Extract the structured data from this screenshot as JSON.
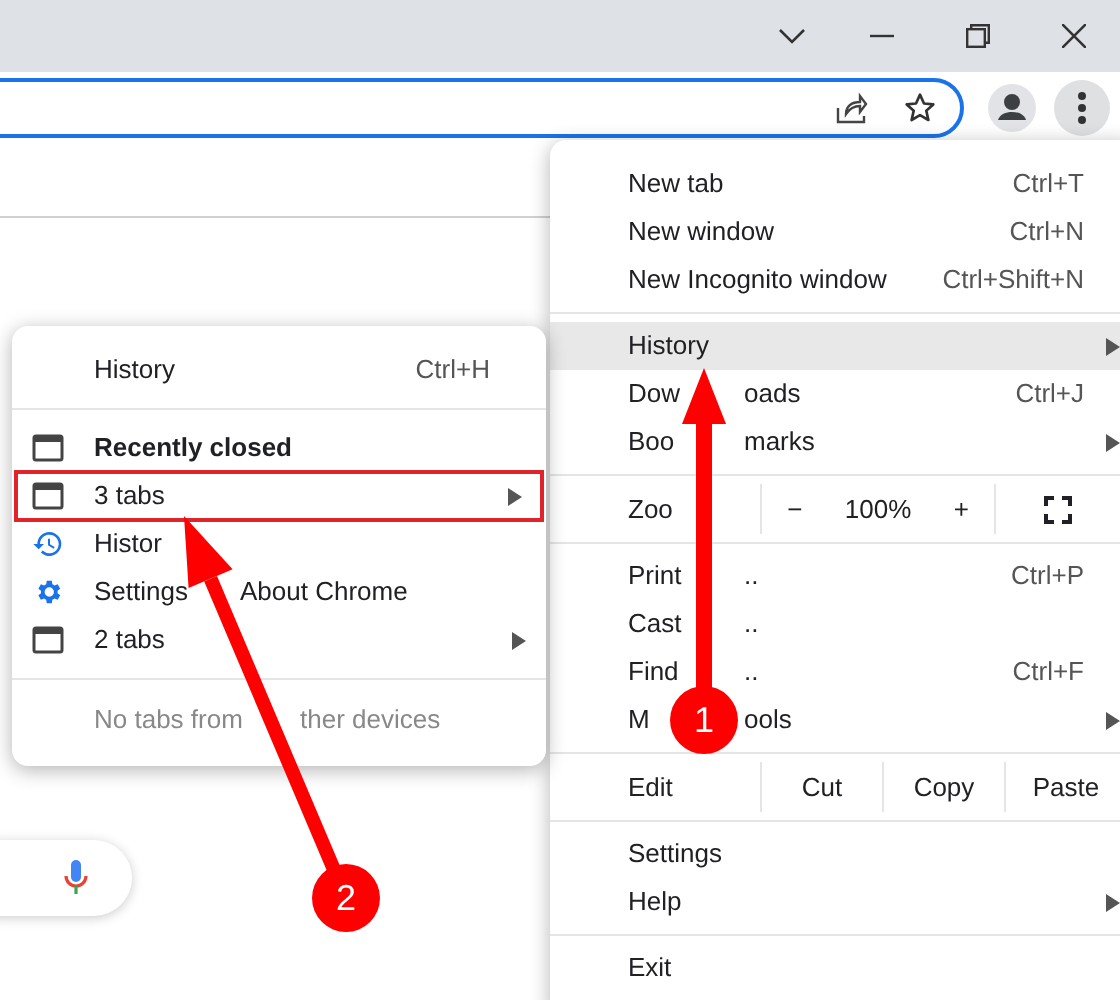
{
  "main_menu": [
    {
      "kind": "item",
      "label": "New tab",
      "shortcut": "Ctrl+T",
      "submenu": false,
      "selected": false
    },
    {
      "kind": "item",
      "label": "New window",
      "shortcut": "Ctrl+N",
      "submenu": false,
      "selected": false
    },
    {
      "kind": "item",
      "label": "New Incognito window",
      "shortcut": "Ctrl+Shift+N",
      "submenu": false,
      "selected": false
    },
    {
      "kind": "separator"
    },
    {
      "kind": "item",
      "label": "History",
      "submenu": true,
      "selected": true
    },
    {
      "kind": "split",
      "parts": [
        "Dow",
        "oads"
      ],
      "shortcut": "Ctrl+J",
      "submenu": false,
      "selected": false
    },
    {
      "kind": "split",
      "parts": [
        "Boo",
        "marks"
      ],
      "submenu": true,
      "selected": false
    },
    {
      "kind": "separator"
    },
    {
      "kind": "zoom",
      "label": "Zoo",
      "minus": "−",
      "value": "100%",
      "plus": "+"
    },
    {
      "kind": "separator"
    },
    {
      "kind": "split",
      "parts": [
        "Print",
        ".."
      ],
      "shortcut": "Ctrl+P",
      "submenu": false,
      "selected": false
    },
    {
      "kind": "split",
      "parts": [
        "Cast",
        ".."
      ],
      "submenu": false,
      "selected": false
    },
    {
      "kind": "split",
      "parts": [
        "Find",
        ".."
      ],
      "shortcut": "Ctrl+F",
      "submenu": false,
      "selected": false
    },
    {
      "kind": "split",
      "parts": [
        "M",
        "ools"
      ],
      "submenu": true,
      "selected": false
    },
    {
      "kind": "separator"
    },
    {
      "kind": "edit",
      "label": "Edit",
      "buttons": [
        "Cut",
        "Copy",
        "Paste"
      ]
    },
    {
      "kind": "separator"
    },
    {
      "kind": "item",
      "label": "Settings",
      "submenu": false,
      "selected": false
    },
    {
      "kind": "item",
      "label": "Help",
      "submenu": true,
      "selected": false
    },
    {
      "kind": "separator"
    },
    {
      "kind": "item",
      "label": "Exit",
      "submenu": false,
      "selected": false
    }
  ],
  "history_menu": [
    {
      "kind": "item",
      "label": "History",
      "shortcut": "Ctrl+H",
      "submenu": false,
      "selected": false
    },
    {
      "kind": "separator"
    },
    {
      "kind": "heading",
      "label": "Recently closed"
    },
    {
      "kind": "tabs",
      "label": "3 tabs",
      "submenu": true,
      "selected": true
    },
    {
      "kind": "history_link",
      "label": "Histor",
      "submenu": false,
      "selected": false
    },
    {
      "kind": "page",
      "parts": [
        "Settings",
        "About Chrome"
      ],
      "submenu": false,
      "selected": false
    },
    {
      "kind": "tabs",
      "label": "2 tabs",
      "submenu": true,
      "selected": false
    },
    {
      "kind": "separator"
    },
    {
      "kind": "note",
      "parts": [
        "No tabs from",
        "ther devices"
      ]
    }
  ],
  "annotations": [
    {
      "number": "1"
    },
    {
      "number": "2"
    }
  ]
}
